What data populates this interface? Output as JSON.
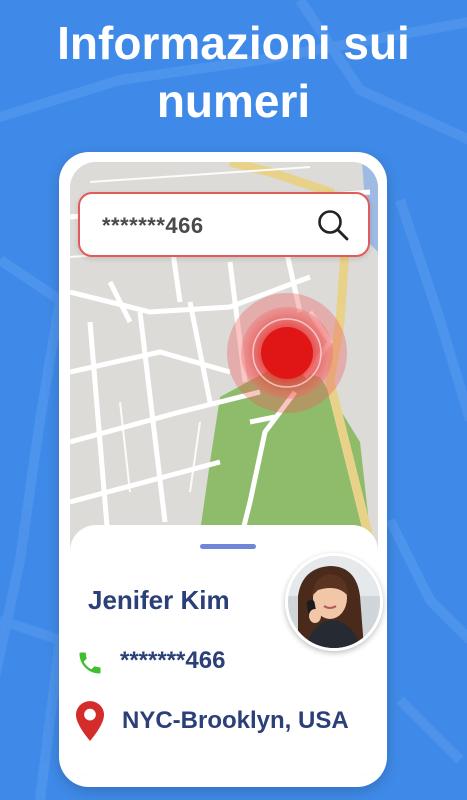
{
  "headline": {
    "line1": "Informazioni sui",
    "line2": "numeri"
  },
  "search": {
    "value": "*******466",
    "icon": "search-icon"
  },
  "contact": {
    "name": "Jenifer Kim",
    "phone": "*******466",
    "location": "NYC-Brooklyn, USA"
  },
  "icons": {
    "phone": "phone-icon",
    "location": "location-pin-icon",
    "avatar": "avatar"
  },
  "colors": {
    "background": "#3f8ae8",
    "headline_text": "#ffffff",
    "contact_text": "#2b3f78",
    "phone_icon": "#3fbf2f",
    "location_icon": "#d42b2b",
    "pin_red": "#e01b1b",
    "search_border": "#e35a5a"
  }
}
